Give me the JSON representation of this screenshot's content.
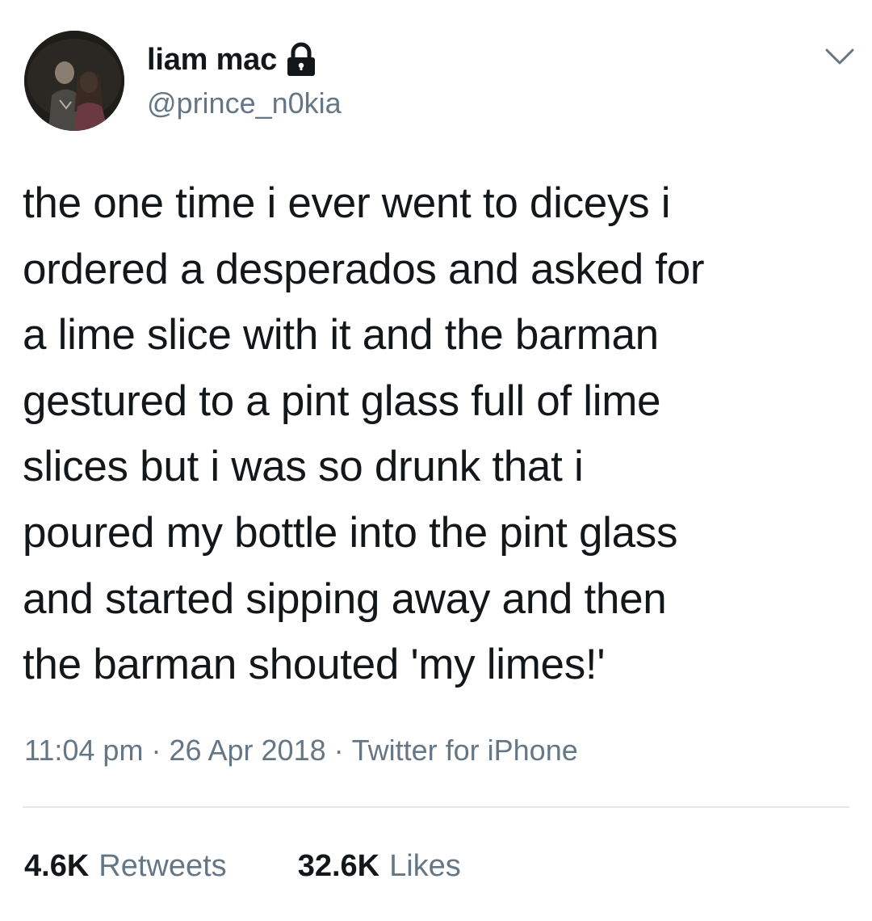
{
  "user": {
    "display_name": "liam mac",
    "handle": "@prince_n0kia",
    "protected_icon": "lock-icon",
    "avatar": "profile-photo"
  },
  "menu_icon": "chevron-down-icon",
  "tweet": {
    "text": "the one time i ever went to diceys i\nordered a desperados and asked for\na lime slice with it and the barman\ngestured to a pint glass full of lime\nslices but i was so drunk that i\npoured my bottle into the pint glass\nand started sipping away and then\nthe barman shouted 'my limes!'"
  },
  "meta": {
    "time": "11:04 pm",
    "date": "26 Apr 2018",
    "source": "Twitter for iPhone",
    "separator": "·"
  },
  "stats": {
    "retweets_count": "4.6K",
    "retweets_label": "Retweets",
    "likes_count": "32.6K",
    "likes_label": "Likes"
  },
  "colors": {
    "text": "#14171a",
    "secondary": "#657786",
    "divider": "#e1e8ed",
    "background": "#ffffff"
  }
}
